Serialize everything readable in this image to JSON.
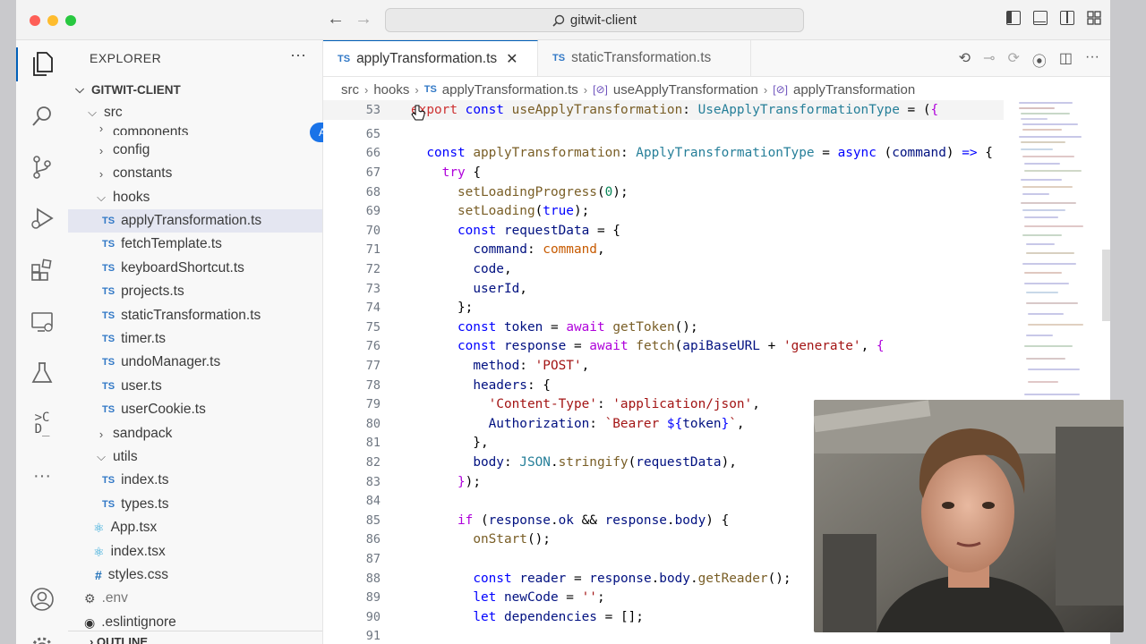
{
  "window": {
    "search_text": "gitwit-client"
  },
  "sidebar": {
    "title": "EXPLORER",
    "more": "···",
    "project": "GITWIT-CLIENT",
    "badge": "A",
    "outline": "OUTLINE",
    "rows": [
      {
        "label": "src",
        "kind": "folder-open"
      },
      {
        "label": "components",
        "kind": "folder"
      },
      {
        "label": "config",
        "kind": "folder"
      },
      {
        "label": "constants",
        "kind": "folder"
      },
      {
        "label": "hooks",
        "kind": "folder-open"
      },
      {
        "label": "applyTransformation.ts",
        "kind": "ts",
        "selected": true
      },
      {
        "label": "fetchTemplate.ts",
        "kind": "ts"
      },
      {
        "label": "keyboardShortcut.ts",
        "kind": "ts"
      },
      {
        "label": "projects.ts",
        "kind": "ts"
      },
      {
        "label": "staticTransformation.ts",
        "kind": "ts"
      },
      {
        "label": "timer.ts",
        "kind": "ts"
      },
      {
        "label": "undoManager.ts",
        "kind": "ts"
      },
      {
        "label": "user.ts",
        "kind": "ts"
      },
      {
        "label": "userCookie.ts",
        "kind": "ts"
      },
      {
        "label": "sandpack",
        "kind": "folder"
      },
      {
        "label": "utils",
        "kind": "folder-open"
      },
      {
        "label": "index.ts",
        "kind": "ts"
      },
      {
        "label": "types.ts",
        "kind": "ts"
      },
      {
        "label": "App.tsx",
        "kind": "react"
      },
      {
        "label": "index.tsx",
        "kind": "react"
      },
      {
        "label": "styles.css",
        "kind": "css"
      },
      {
        "label": ".env",
        "kind": "gear"
      },
      {
        "label": ".eslintignore",
        "kind": "circle"
      }
    ]
  },
  "tabs": [
    {
      "label": "applyTransformation.ts",
      "ts": "TS",
      "close": "✕"
    },
    {
      "label": "staticTransformation.ts",
      "ts": "TS"
    }
  ],
  "breadcrumb": {
    "parts": [
      "src",
      "hooks",
      "applyTransformation.ts",
      "useApplyTransformation",
      "applyTransformation"
    ],
    "ts": "TS",
    "sym": "[⊘]"
  },
  "code": {
    "sticky": {
      "num": "53"
    },
    "line_numbers": [
      "65",
      "66",
      "67",
      "68",
      "69",
      "70",
      "71",
      "72",
      "73",
      "74",
      "75",
      "76",
      "77",
      "78",
      "79",
      "80",
      "81",
      "82",
      "83",
      "84",
      "85",
      "86",
      "87",
      "88",
      "89",
      "90",
      "91"
    ]
  },
  "colors": {
    "accent": "#005fb8",
    "badge": "#1a73e8",
    "selected_row": "#e4e6f1"
  }
}
